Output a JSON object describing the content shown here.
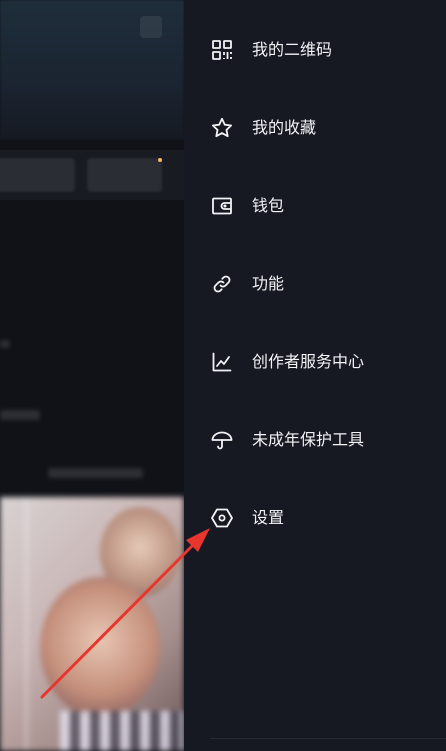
{
  "drawer": {
    "items": [
      {
        "label": "我的二维码",
        "icon": "qrcode-icon"
      },
      {
        "label": "我的收藏",
        "icon": "star-icon"
      },
      {
        "label": "钱包",
        "icon": "wallet-icon"
      },
      {
        "label": "功能",
        "icon": "link-icon"
      },
      {
        "label": "创作者服务中心",
        "icon": "trend-chart-icon"
      },
      {
        "label": "未成年保护工具",
        "icon": "umbrella-icon"
      },
      {
        "label": "设置",
        "icon": "settings-hexagon-icon"
      }
    ]
  },
  "annotation": {
    "color": "#e8352d"
  },
  "colors": {
    "drawer_bg": "#161922",
    "text": "#f2f3f5"
  }
}
